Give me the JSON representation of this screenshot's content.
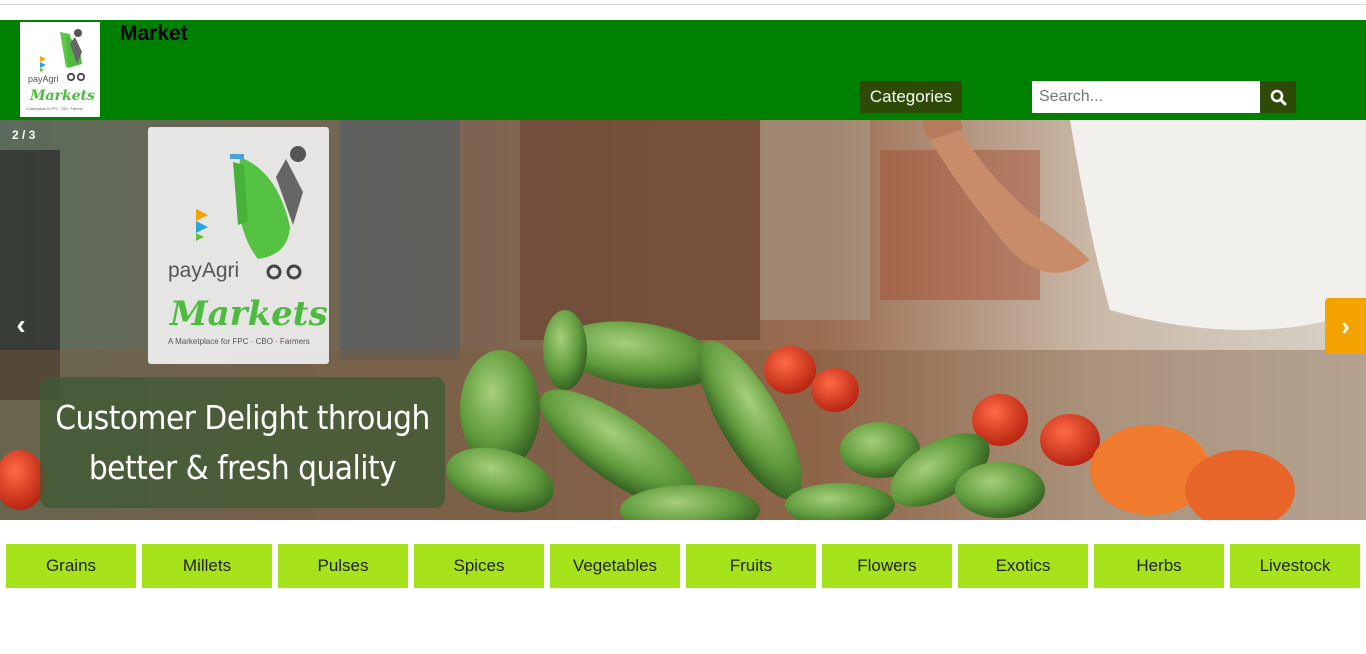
{
  "header": {
    "title": "Market",
    "logo": {
      "name": "payAgri",
      "script": "Markets",
      "tagline": "A Marketplace for FPC · CBO · Farmers"
    },
    "categories_label": "Categories",
    "search_placeholder": "Search...",
    "search_icon": "search-icon",
    "background_color": "#008000"
  },
  "slider": {
    "counter": "2 / 3",
    "caption_line1": "Customer Delight through",
    "caption_line2": "better & fresh quality",
    "prev_glyph": "‹",
    "next_glyph": "›",
    "next_color": "#f5a300"
  },
  "categories": [
    "Grains",
    "Millets",
    "Pulses",
    "Spices",
    "Vegetables",
    "Fruits",
    "Flowers",
    "Exotics",
    "Herbs",
    "Livestock"
  ],
  "category_color": "#a6e31a"
}
